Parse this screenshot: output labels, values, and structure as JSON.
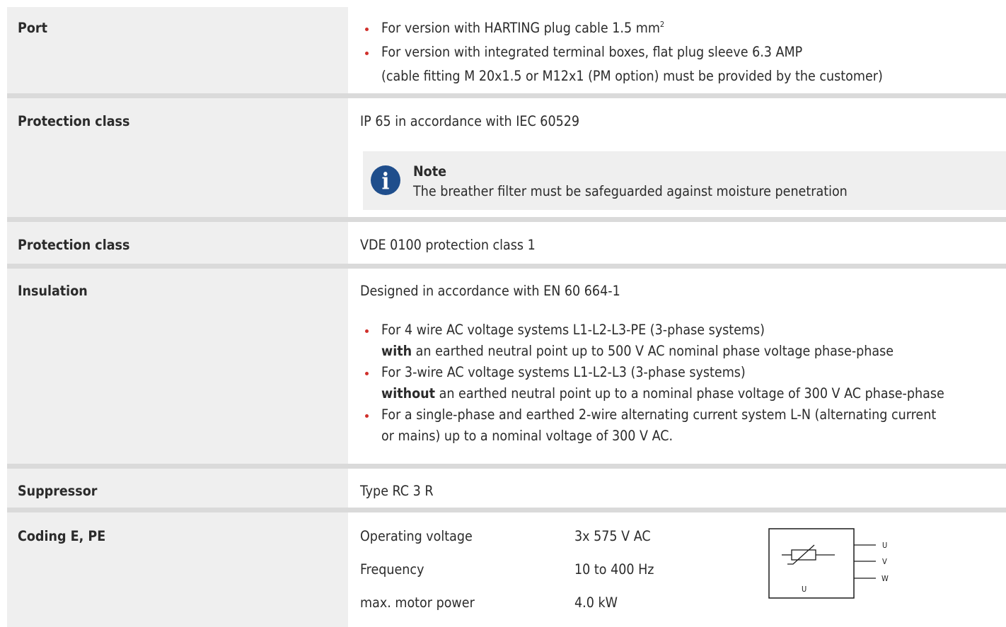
{
  "rows": {
    "port": {
      "label": "Port",
      "bullets": [
        {
          "text": "For version with HARTING plug cable 1.5 mm",
          "sup": "2"
        },
        {
          "text": "For version with  integrated terminal boxes, flat plug sleeve 6.3 AMP",
          "cont": "(cable fitting M 20x1.5 or M12x1 (PM option) must be provided by the customer)"
        }
      ]
    },
    "protection1": {
      "label": "Protection class",
      "value": "IP 65 in accordance with IEC 60529",
      "note_title": "Note",
      "note_text": "The breather filter must be safeguarded against moisture penetration",
      "note_icon": "info-icon"
    },
    "protection2": {
      "label": "Protection class",
      "value": "VDE 0100 protection class 1"
    },
    "insulation": {
      "label": "Insulation",
      "value": "Designed in accordance with EN 60 664-1",
      "bullets": [
        {
          "text": "For 4 wire AC voltage systems L1-L2-L3-PE (3-phase systems)",
          "cont_bold": "with",
          "cont": " an earthed neutral point up to 500 V AC nominal phase voltage phase-phase"
        },
        {
          "text": "For 3-wire AC voltage systems L1-L2-L3 (3-phase systems)",
          "cont_bold": "without",
          "cont": " an earthed neutral point up to a nominal phase voltage of 300 V AC phase-phase"
        },
        {
          "text": "For a single-phase and earthed 2-wire alternating current system L-N (alternating current",
          "cont": "or mains) up to a nominal voltage of 300 V AC."
        }
      ]
    },
    "suppressor": {
      "label": "Suppressor",
      "value": "Type RC 3 R"
    },
    "coding": {
      "label": "Coding E, PE",
      "specs": [
        {
          "name": "Operating voltage",
          "value": "3x 575 V AC"
        },
        {
          "name": "Frequency",
          "value": "10 to 400 Hz"
        },
        {
          "name": "max. motor power",
          "value": "4.0 kW"
        }
      ],
      "diagram": {
        "inner_label": "U",
        "outputs": [
          "U",
          "V",
          "W"
        ]
      }
    }
  },
  "colors": {
    "bullet": "#d0302b",
    "label_bg": "#efefef",
    "separator": "#dadada",
    "note_icon": "#1f4e8c"
  }
}
